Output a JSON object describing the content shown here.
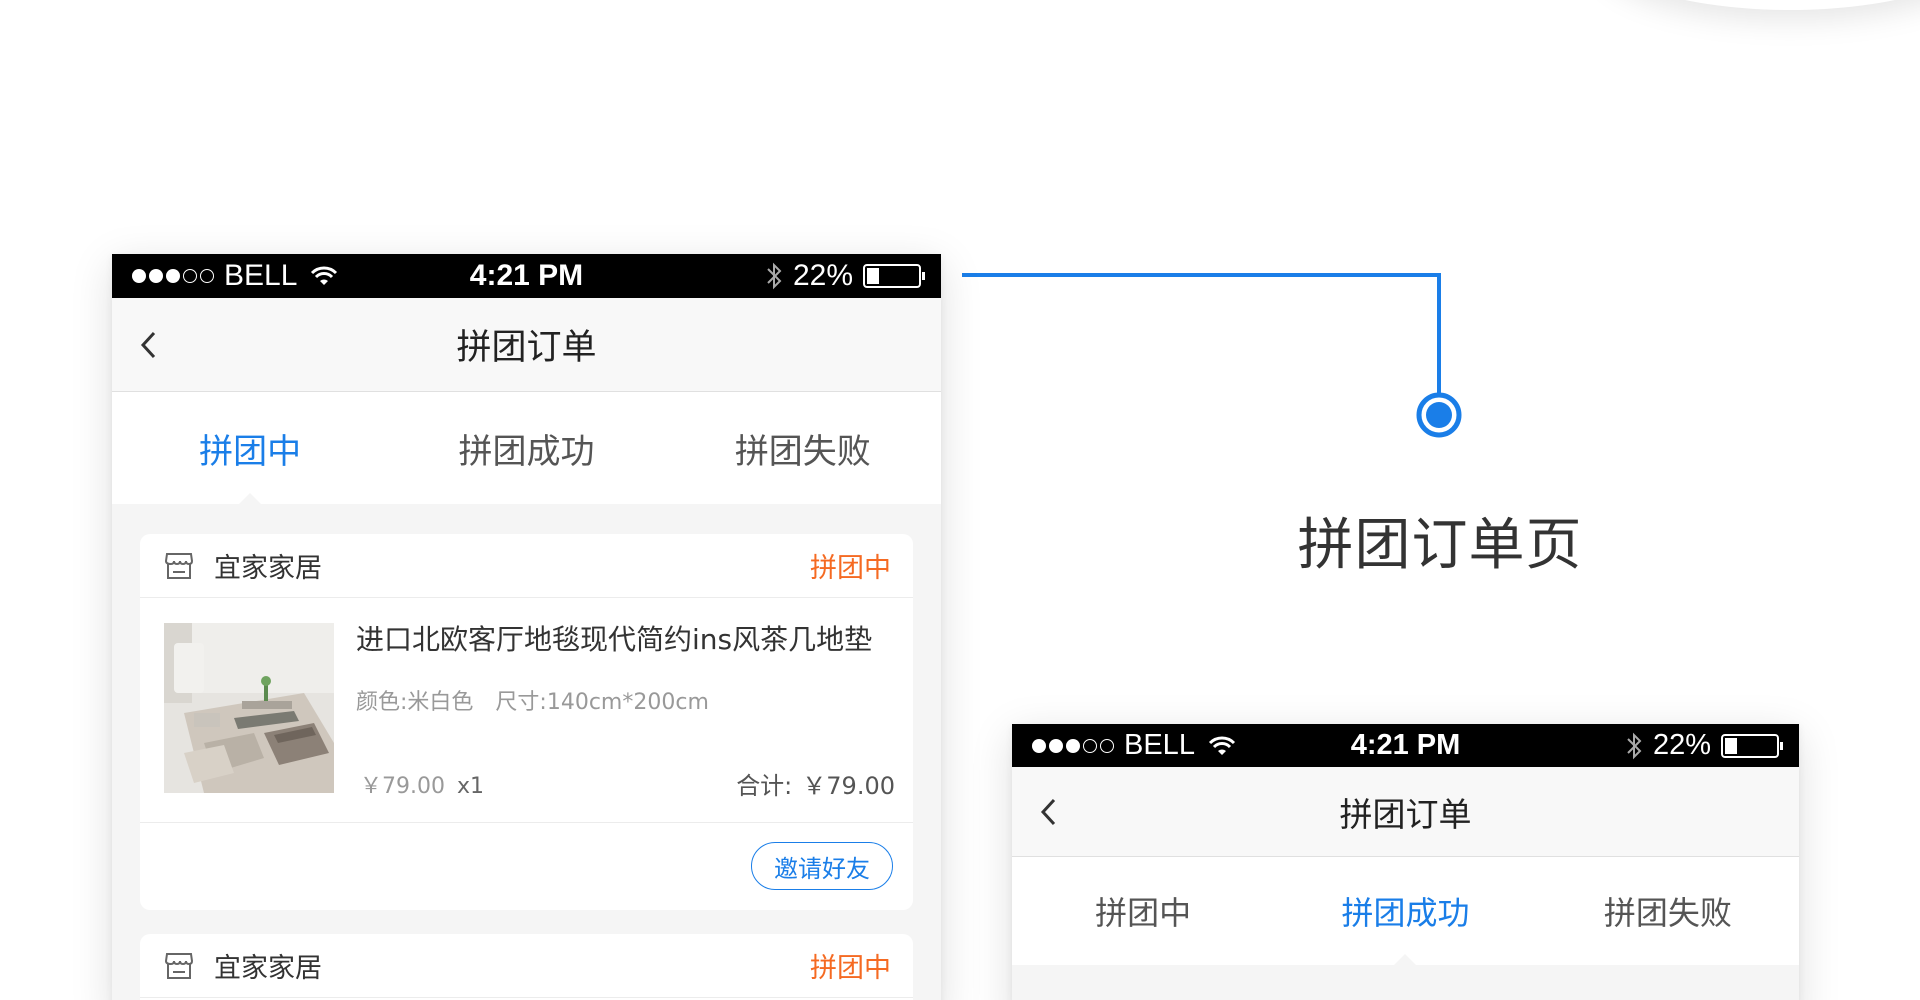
{
  "statusbar": {
    "carrier": "BELL",
    "time": "4:21 PM",
    "battery_text": "22%",
    "battery_level": 0.22,
    "signal_filled": 3,
    "signal_total": 5
  },
  "page_label": "拼团订单页",
  "colors": {
    "accent": "#1a7ee8",
    "status_orange": "#f56a22"
  },
  "left_phone": {
    "nav": {
      "title": "拼团订单",
      "back_icon": "chevron-left-icon"
    },
    "tabs": [
      {
        "label": "拼团中",
        "active": true
      },
      {
        "label": "拼团成功",
        "active": false
      },
      {
        "label": "拼团失败",
        "active": false
      }
    ],
    "orders": [
      {
        "store_icon": "store-icon",
        "store_name": "宜家家居",
        "status": "拼团中",
        "product": {
          "title": "进口北欧客厅地毯现代简约ins风茶几地垫",
          "color": "颜色:米白色",
          "size": "尺寸:140cm*200cm",
          "unit_price": "￥79.00",
          "quantity": "x1",
          "total_label": "合计:",
          "total": "￥79.00"
        },
        "action": "邀请好友"
      },
      {
        "store_icon": "store-icon",
        "store_name": "宜家家居",
        "status": "拼团中"
      }
    ]
  },
  "right_phone": {
    "nav": {
      "title": "拼团订单",
      "back_icon": "chevron-left-icon"
    },
    "tabs": [
      {
        "label": "拼团中",
        "active": false
      },
      {
        "label": "拼团成功",
        "active": true
      },
      {
        "label": "拼团失败",
        "active": false
      }
    ]
  }
}
